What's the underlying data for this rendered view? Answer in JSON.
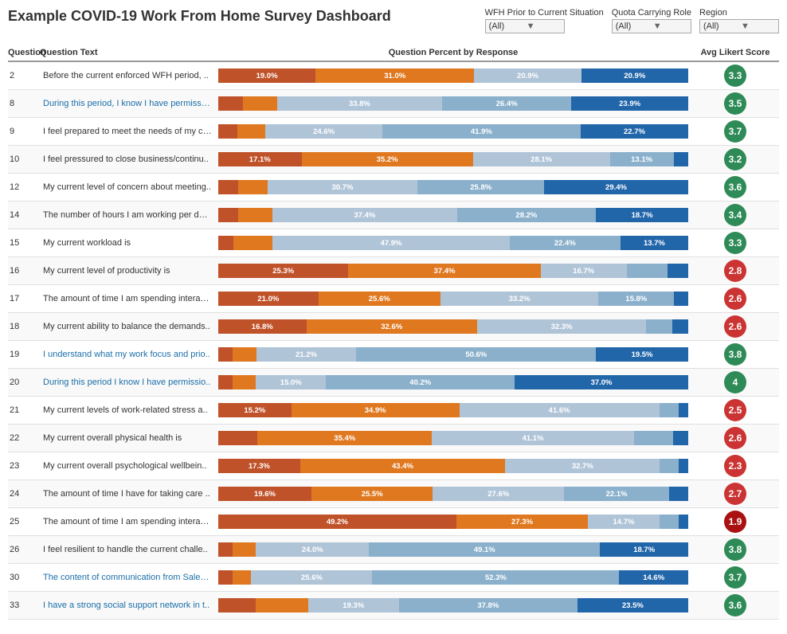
{
  "title": "Example COVID-19 Work From Home Survey Dashboard",
  "filters": [
    {
      "id": "wfh",
      "label": "WFH Prior to Current Situation",
      "value": "(All)"
    },
    {
      "id": "quota",
      "label": "Quota Carrying Role",
      "value": "(All)"
    },
    {
      "id": "region",
      "label": "Region",
      "value": "(All)"
    }
  ],
  "columns": {
    "question": "Question",
    "text": "Question Text",
    "chart": "Question Percent by Response",
    "score": "Avg Likert Score"
  },
  "rows": [
    {
      "q": 2,
      "text": "Before the current enforced WFH period, ..",
      "textColor": "black",
      "segments": [
        {
          "color": "#c0522a",
          "pct": 19.0,
          "label": "19.0%"
        },
        {
          "color": "#e07820",
          "pct": 31.0,
          "label": "31.0%"
        },
        {
          "color": "#b0c4d8",
          "pct": 20.9,
          "label": "20.9%"
        },
        {
          "color": "#2266aa",
          "pct": 20.9,
          "label": "20.9%"
        }
      ],
      "score": 3.3,
      "scoreType": "green"
    },
    {
      "q": 8,
      "text": "During this period, I know I have permissio..",
      "textColor": "blue",
      "segments": [
        {
          "color": "#c0522a",
          "pct": 5,
          "label": ""
        },
        {
          "color": "#e07820",
          "pct": 7,
          "label": ""
        },
        {
          "color": "#b0c4d8",
          "pct": 33.8,
          "label": "33.8%"
        },
        {
          "color": "#8ab0cc",
          "pct": 26.4,
          "label": "26.4%"
        },
        {
          "color": "#2266aa",
          "pct": 23.9,
          "label": "23.9%"
        }
      ],
      "score": 3.5,
      "scoreType": "green"
    },
    {
      "q": 9,
      "text": "I feel prepared to meet the needs of my cu..",
      "textColor": "black",
      "segments": [
        {
          "color": "#c0522a",
          "pct": 4,
          "label": ""
        },
        {
          "color": "#e07820",
          "pct": 6,
          "label": ""
        },
        {
          "color": "#b0c4d8",
          "pct": 24.6,
          "label": "24.6%"
        },
        {
          "color": "#8ab0cc",
          "pct": 41.9,
          "label": "41.9%"
        },
        {
          "color": "#2266aa",
          "pct": 22.7,
          "label": "22.7%"
        }
      ],
      "score": 3.7,
      "scoreType": "green"
    },
    {
      "q": 10,
      "text": "I feel pressured to close business/continu..",
      "textColor": "black",
      "segments": [
        {
          "color": "#c0522a",
          "pct": 17.1,
          "label": "17.1%"
        },
        {
          "color": "#e07820",
          "pct": 35.2,
          "label": "35.2%"
        },
        {
          "color": "#b0c4d8",
          "pct": 28.1,
          "label": "28.1%"
        },
        {
          "color": "#8ab0cc",
          "pct": 13.1,
          "label": "13.1%"
        },
        {
          "color": "#2266aa",
          "pct": 3,
          "label": ""
        }
      ],
      "score": 3.2,
      "scoreType": "green"
    },
    {
      "q": 12,
      "text": "My current level of concern about meeting..",
      "textColor": "black",
      "segments": [
        {
          "color": "#c0522a",
          "pct": 4,
          "label": ""
        },
        {
          "color": "#e07820",
          "pct": 6,
          "label": ""
        },
        {
          "color": "#b0c4d8",
          "pct": 30.7,
          "label": "30.7%"
        },
        {
          "color": "#8ab0cc",
          "pct": 25.8,
          "label": "25.8%"
        },
        {
          "color": "#2266aa",
          "pct": 29.4,
          "label": "29.4%"
        }
      ],
      "score": 3.6,
      "scoreType": "green"
    },
    {
      "q": 14,
      "text": "The number of hours I am working per day ..",
      "textColor": "black",
      "segments": [
        {
          "color": "#c0522a",
          "pct": 4,
          "label": ""
        },
        {
          "color": "#e07820",
          "pct": 7,
          "label": ""
        },
        {
          "color": "#b0c4d8",
          "pct": 37.4,
          "label": "37.4%"
        },
        {
          "color": "#8ab0cc",
          "pct": 28.2,
          "label": "28.2%"
        },
        {
          "color": "#2266aa",
          "pct": 18.7,
          "label": "18.7%"
        }
      ],
      "score": 3.4,
      "scoreType": "green"
    },
    {
      "q": 15,
      "text": "My current workload is",
      "textColor": "black",
      "segments": [
        {
          "color": "#c0522a",
          "pct": 3,
          "label": ""
        },
        {
          "color": "#e07820",
          "pct": 8,
          "label": ""
        },
        {
          "color": "#b0c4d8",
          "pct": 47.9,
          "label": "47.9%"
        },
        {
          "color": "#8ab0cc",
          "pct": 22.4,
          "label": "22.4%"
        },
        {
          "color": "#2266aa",
          "pct": 13.7,
          "label": "13.7%"
        }
      ],
      "score": 3.3,
      "scoreType": "green"
    },
    {
      "q": 16,
      "text": "My current level of productivity is",
      "textColor": "black",
      "segments": [
        {
          "color": "#c0522a",
          "pct": 25.3,
          "label": "25.3%"
        },
        {
          "color": "#e07820",
          "pct": 37.4,
          "label": "37.4%"
        },
        {
          "color": "#b0c4d8",
          "pct": 16.7,
          "label": "16.7%"
        },
        {
          "color": "#8ab0cc",
          "pct": 8,
          "label": ""
        },
        {
          "color": "#2266aa",
          "pct": 4,
          "label": ""
        }
      ],
      "score": 2.8,
      "scoreType": "red"
    },
    {
      "q": 17,
      "text": "The amount of time I am spending interact..",
      "textColor": "black",
      "segments": [
        {
          "color": "#c0522a",
          "pct": 21.0,
          "label": "21.0%"
        },
        {
          "color": "#e07820",
          "pct": 25.6,
          "label": "25.6%"
        },
        {
          "color": "#b0c4d8",
          "pct": 33.2,
          "label": "33.2%"
        },
        {
          "color": "#8ab0cc",
          "pct": 15.8,
          "label": "15.8%"
        },
        {
          "color": "#2266aa",
          "pct": 3,
          "label": ""
        }
      ],
      "score": 2.6,
      "scoreType": "red"
    },
    {
      "q": 18,
      "text": "My current ability to balance the demands..",
      "textColor": "black",
      "segments": [
        {
          "color": "#c0522a",
          "pct": 16.8,
          "label": "16.8%"
        },
        {
          "color": "#e07820",
          "pct": 32.6,
          "label": "32.6%"
        },
        {
          "color": "#b0c4d8",
          "pct": 32.3,
          "label": "32.3%"
        },
        {
          "color": "#8ab0cc",
          "pct": 5,
          "label": ""
        },
        {
          "color": "#2266aa",
          "pct": 3,
          "label": ""
        }
      ],
      "score": 2.6,
      "scoreType": "red"
    },
    {
      "q": 19,
      "text": "I understand what my work focus and prio..",
      "textColor": "blue",
      "segments": [
        {
          "color": "#c0522a",
          "pct": 3,
          "label": ""
        },
        {
          "color": "#e07820",
          "pct": 5,
          "label": ""
        },
        {
          "color": "#b0c4d8",
          "pct": 21.2,
          "label": "21.2%"
        },
        {
          "color": "#8ab0cc",
          "pct": 50.6,
          "label": "50.6%"
        },
        {
          "color": "#2266aa",
          "pct": 19.5,
          "label": "19.5%"
        }
      ],
      "score": 3.8,
      "scoreType": "green"
    },
    {
      "q": 20,
      "text": "During this period I know I have permissio..",
      "textColor": "blue",
      "segments": [
        {
          "color": "#c0522a",
          "pct": 3,
          "label": ""
        },
        {
          "color": "#e07820",
          "pct": 5,
          "label": ""
        },
        {
          "color": "#b0c4d8",
          "pct": 15.0,
          "label": "15.0%"
        },
        {
          "color": "#8ab0cc",
          "pct": 40.2,
          "label": "40.2%"
        },
        {
          "color": "#2266aa",
          "pct": 37.0,
          "label": "37.0%"
        }
      ],
      "score": 4.0,
      "scoreType": "green"
    },
    {
      "q": 21,
      "text": "My current levels of work-related stress a..",
      "textColor": "black",
      "segments": [
        {
          "color": "#c0522a",
          "pct": 15.2,
          "label": "15.2%"
        },
        {
          "color": "#e07820",
          "pct": 34.9,
          "label": "34.9%"
        },
        {
          "color": "#b0c4d8",
          "pct": 41.6,
          "label": "41.6%"
        },
        {
          "color": "#8ab0cc",
          "pct": 4,
          "label": ""
        },
        {
          "color": "#2266aa",
          "pct": 2,
          "label": ""
        }
      ],
      "score": 2.5,
      "scoreType": "red"
    },
    {
      "q": 22,
      "text": "My current overall physical health is",
      "textColor": "black",
      "segments": [
        {
          "color": "#c0522a",
          "pct": 8,
          "label": ""
        },
        {
          "color": "#e07820",
          "pct": 35.4,
          "label": "35.4%"
        },
        {
          "color": "#b0c4d8",
          "pct": 41.1,
          "label": "41.1%"
        },
        {
          "color": "#8ab0cc",
          "pct": 8,
          "label": ""
        },
        {
          "color": "#2266aa",
          "pct": 3,
          "label": ""
        }
      ],
      "score": 2.6,
      "scoreType": "red"
    },
    {
      "q": 23,
      "text": "My current overall psychological wellbein..",
      "textColor": "black",
      "segments": [
        {
          "color": "#c0522a",
          "pct": 17.3,
          "label": "17.3%"
        },
        {
          "color": "#e07820",
          "pct": 43.4,
          "label": "43.4%"
        },
        {
          "color": "#b0c4d8",
          "pct": 32.7,
          "label": "32.7%"
        },
        {
          "color": "#8ab0cc",
          "pct": 4,
          "label": ""
        },
        {
          "color": "#2266aa",
          "pct": 2,
          "label": ""
        }
      ],
      "score": 2.3,
      "scoreType": "red"
    },
    {
      "q": 24,
      "text": "The amount of time I have for taking care ..",
      "textColor": "black",
      "segments": [
        {
          "color": "#c0522a",
          "pct": 19.6,
          "label": "19.6%"
        },
        {
          "color": "#e07820",
          "pct": 25.5,
          "label": "25.5%"
        },
        {
          "color": "#b0c4d8",
          "pct": 27.6,
          "label": "27.6%"
        },
        {
          "color": "#8ab0cc",
          "pct": 22.1,
          "label": "22.1%"
        },
        {
          "color": "#2266aa",
          "pct": 4,
          "label": ""
        }
      ],
      "score": 2.7,
      "scoreType": "red"
    },
    {
      "q": 25,
      "text": "The amount of time I am spending interact..",
      "textColor": "black",
      "segments": [
        {
          "color": "#c0522a",
          "pct": 49.2,
          "label": "49.2%"
        },
        {
          "color": "#e07820",
          "pct": 27.3,
          "label": "27.3%"
        },
        {
          "color": "#b0c4d8",
          "pct": 14.7,
          "label": "14.7%"
        },
        {
          "color": "#8ab0cc",
          "pct": 4,
          "label": ""
        },
        {
          "color": "#2266aa",
          "pct": 2,
          "label": ""
        }
      ],
      "score": 1.9,
      "scoreType": "dark-red"
    },
    {
      "q": 26,
      "text": "I feel resilient to handle the current challe..",
      "textColor": "black",
      "segments": [
        {
          "color": "#c0522a",
          "pct": 3,
          "label": ""
        },
        {
          "color": "#e07820",
          "pct": 5,
          "label": ""
        },
        {
          "color": "#b0c4d8",
          "pct": 24.0,
          "label": "24.0%"
        },
        {
          "color": "#8ab0cc",
          "pct": 49.1,
          "label": "49.1%"
        },
        {
          "color": "#2266aa",
          "pct": 18.7,
          "label": "18.7%"
        }
      ],
      "score": 3.8,
      "scoreType": "green"
    },
    {
      "q": 30,
      "text": "The content of communication from Salesf..",
      "textColor": "blue",
      "segments": [
        {
          "color": "#c0522a",
          "pct": 3,
          "label": ""
        },
        {
          "color": "#e07820",
          "pct": 4,
          "label": ""
        },
        {
          "color": "#b0c4d8",
          "pct": 25.6,
          "label": "25.6%"
        },
        {
          "color": "#8ab0cc",
          "pct": 52.3,
          "label": "52.3%"
        },
        {
          "color": "#2266aa",
          "pct": 14.6,
          "label": "14.6%"
        }
      ],
      "score": 3.7,
      "scoreType": "green"
    },
    {
      "q": 33,
      "text": "I have a strong social support network in t..",
      "textColor": "blue",
      "segments": [
        {
          "color": "#c0522a",
          "pct": 8,
          "label": ""
        },
        {
          "color": "#e07820",
          "pct": 11,
          "label": ""
        },
        {
          "color": "#b0c4d8",
          "pct": 19.3,
          "label": "19.3%"
        },
        {
          "color": "#8ab0cc",
          "pct": 37.8,
          "label": "37.8%"
        },
        {
          "color": "#2266aa",
          "pct": 23.5,
          "label": "23.5%"
        }
      ],
      "score": 3.6,
      "scoreType": "green"
    }
  ]
}
